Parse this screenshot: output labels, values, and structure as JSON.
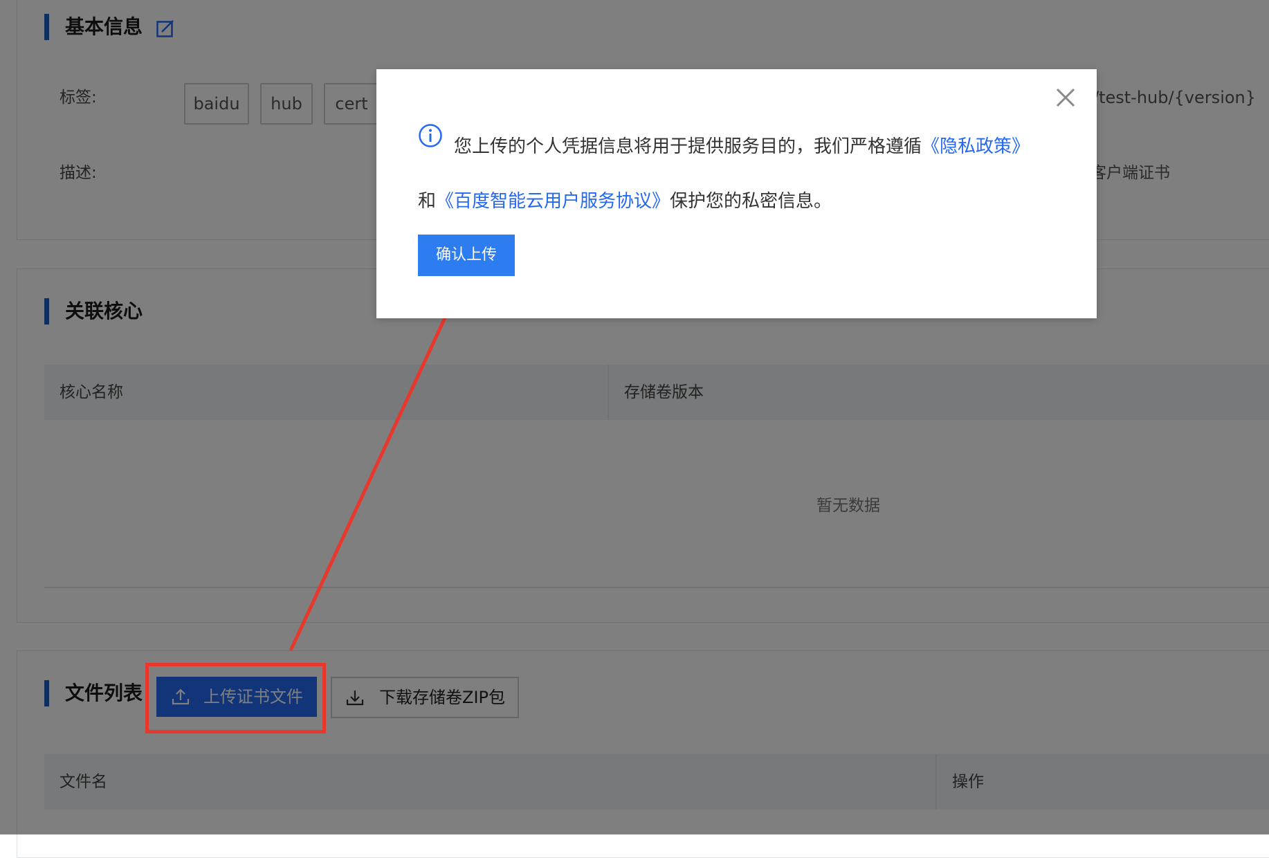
{
  "basic_info": {
    "title": "基本信息",
    "edit_icon": "edit-icon",
    "tags_label": "标签:",
    "tags": [
      "baidu",
      "hub",
      "cert"
    ],
    "desc_label": "描述:",
    "behind_modal_path": "/test-hub/{version}",
    "behind_modal_desc": "客户端证书"
  },
  "cores": {
    "title": "关联核心",
    "columns": [
      "核心名称",
      "存储卷版本"
    ],
    "empty_text": "暂无数据"
  },
  "files": {
    "title": "文件列表",
    "upload_button": "上传证书文件",
    "upload_icon": "upload-icon",
    "download_button": "下载存储卷ZIP包",
    "download_icon": "download-icon",
    "columns": [
      "文件名",
      "操作"
    ]
  },
  "modal": {
    "info_icon": "info-icon",
    "close_icon": "close-icon",
    "text_before": "您上传的个人凭据信息将用于提供服务目的，我们严格遵循",
    "privacy_link": "《隐私政策》",
    "text_middle": "和",
    "agreement_link": "《百度智能云用户服务协议》",
    "text_after": "保护您的私密信息。",
    "confirm_button": "确认上传"
  },
  "annotation": {
    "highlight_color": "#e8372c"
  },
  "colors": {
    "primary": "#2468f2",
    "section_bar": "#1f5fbf",
    "annotation": "#e8372c"
  }
}
